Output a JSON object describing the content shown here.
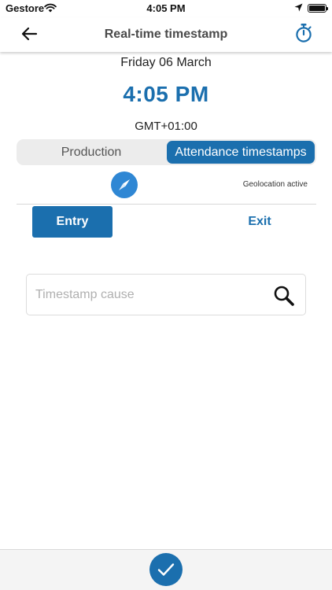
{
  "status_bar": {
    "carrier": "Gestore",
    "time": "4:05 PM"
  },
  "header": {
    "title": "Real-time timestamp",
    "back_icon": "arrow-left-icon",
    "timer_icon": "stopwatch-icon"
  },
  "clock": {
    "date": "Friday 06 March",
    "time": "4:05 PM",
    "timezone": "GMT+01:00"
  },
  "tabs": [
    {
      "label": "Production",
      "selected": false
    },
    {
      "label": "Attendance timestamps",
      "selected": true
    }
  ],
  "geolocation": {
    "icon": "compass-icon",
    "label": "Geolocation active"
  },
  "direction": {
    "entry_label": "Entry",
    "exit_label": "Exit",
    "selected": "Entry"
  },
  "search": {
    "value": "",
    "placeholder": "Timestamp cause",
    "icon": "search-icon"
  },
  "footer": {
    "confirm_icon": "checkmark-icon"
  },
  "colors": {
    "accent": "#1b6fae",
    "compass": "#2f87d4",
    "title_text": "#4a4a4a"
  }
}
